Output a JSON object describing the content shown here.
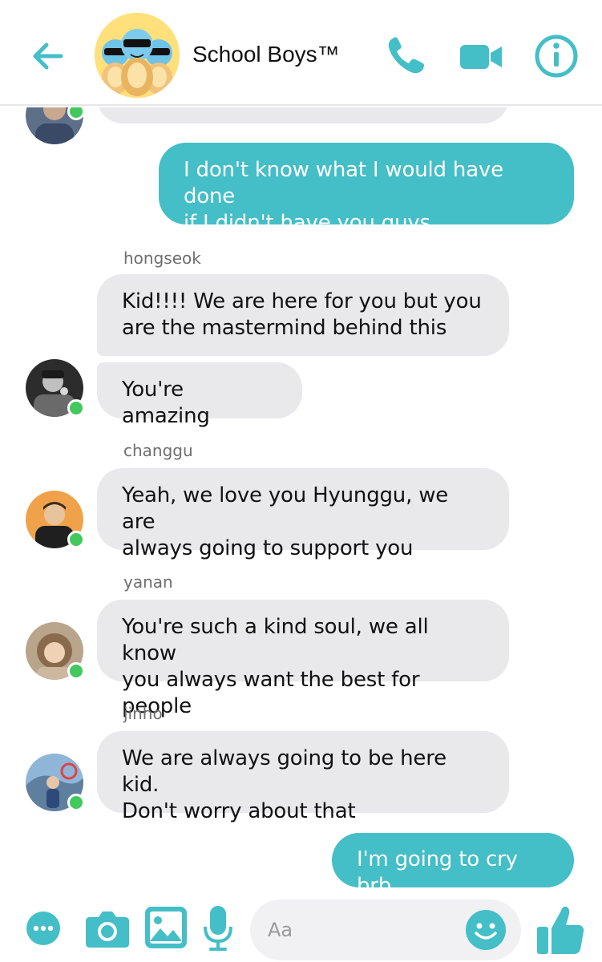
{
  "header": {
    "title": "School Boys™",
    "back_icon": "arrow-left-icon",
    "call_icon": "phone-icon",
    "video_icon": "video-camera-icon",
    "info_icon": "info-icon",
    "accent_color": "#44bec7"
  },
  "messages": [
    {
      "direction": "in",
      "text": ""
    },
    {
      "direction": "out",
      "text": "I don't know what I would have done\nif I didn't have you guys"
    },
    {
      "sender": "hongseok",
      "direction": "in",
      "text": "Kid!!!! We are here for you but you\nare the mastermind behind this"
    },
    {
      "sender": "hongseok",
      "direction": "in",
      "text": "You're amazing"
    },
    {
      "sender": "changgu",
      "direction": "in",
      "text": "Yeah, we love you Hyunggu, we are\nalways going to support you"
    },
    {
      "sender": "yanan",
      "direction": "in",
      "text": "You're such a kind soul, we all know\nyou always want the best for people"
    },
    {
      "sender": "jinho",
      "direction": "in",
      "text": "We are always going to be here kid.\nDon't worry about that"
    },
    {
      "direction": "out",
      "text": "I'm going to cry brb"
    }
  ],
  "composer": {
    "placeholder": "Aa",
    "more_icon": "more-dots-icon",
    "camera_icon": "camera-icon",
    "gallery_icon": "image-icon",
    "mic_icon": "microphone-icon",
    "emoji_icon": "smiley-icon",
    "like_icon": "thumbs-up-icon"
  },
  "colors": {
    "outgoing_bubble": "#44bec7",
    "incoming_bubble": "#e9e9eb",
    "presence": "#42c85c"
  }
}
